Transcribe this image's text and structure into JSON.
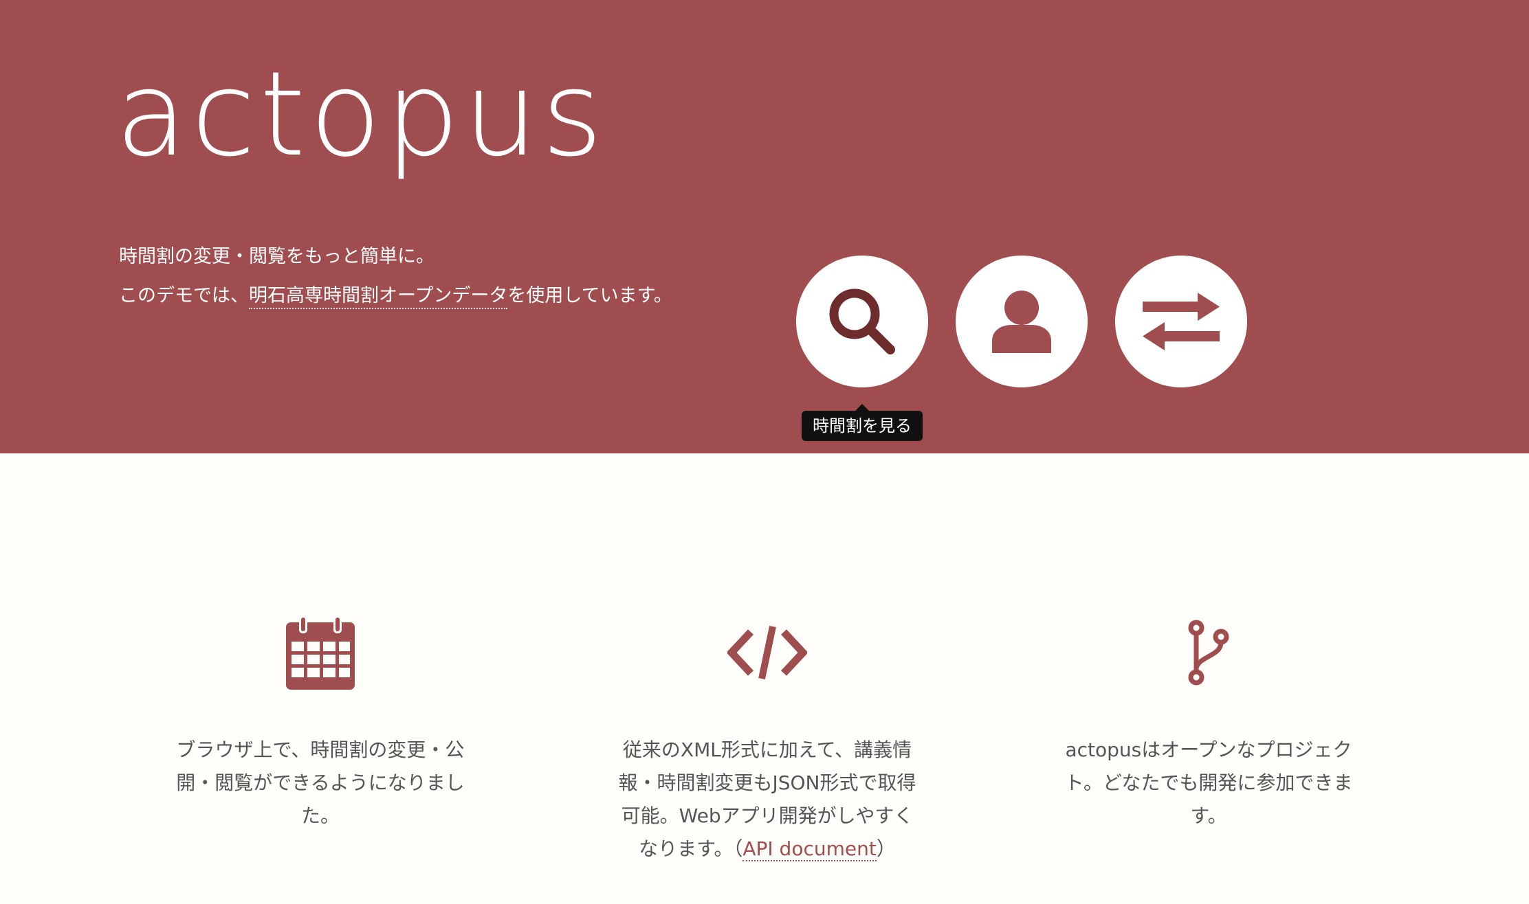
{
  "brand": {
    "name": "actopus"
  },
  "hero": {
    "line1": "時間割の変更・閲覧をもっと簡単に。",
    "line2_prefix": "このデモでは、",
    "line2_link": "明石高専時間割オープンデータ",
    "line2_suffix": "を使用しています。"
  },
  "actions": {
    "search_icon": "search-icon",
    "user_icon": "user-icon",
    "swap_icon": "exchange-arrows-icon",
    "tooltip": "時間割を見る"
  },
  "features": [
    {
      "icon": "calendar-icon",
      "text": "ブラウザ上で、時間割の変更・公開・閲覧ができるようになりました。"
    },
    {
      "icon": "code-icon",
      "text_prefix": "従来のXML形式に加えて、講義情報・時間割変更もJSON形式で取得可能。Webアプリ開発がしやすくなります。（",
      "link": "API document",
      "text_suffix": "）"
    },
    {
      "icon": "code-fork-icon",
      "text": "actopusはオープンなプロジェクト。どなたでも開発に参加できます。"
    }
  ],
  "colors": {
    "brand": "#a04d4f",
    "icon_dark": "#6e2c2d",
    "background": "#fefdf9",
    "body_text": "#555555"
  }
}
